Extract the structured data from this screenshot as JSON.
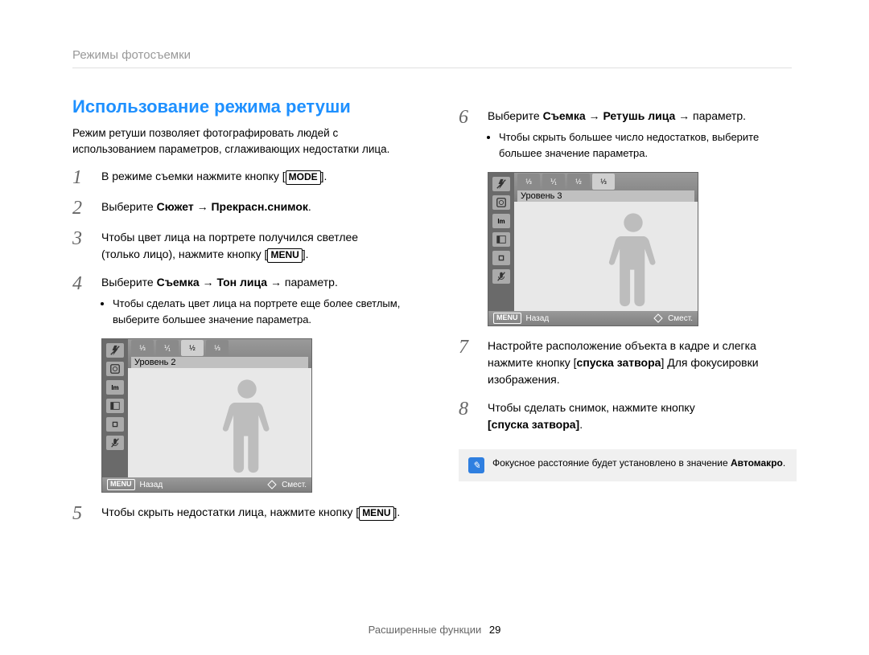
{
  "header": {
    "breadcrumb": "Режимы фотосъемки"
  },
  "section_title": "Использование режима ретуши",
  "intro": "Режим ретуши позволяет фотографировать людей с использованием параметров, сглаживающих недостатки лица.",
  "steps": {
    "s1": {
      "num": "1",
      "pre": "В режиме съемки нажмите кнопку [",
      "btn": "MODE",
      "post": "]."
    },
    "s2": {
      "num": "2",
      "text_before": "Выберите ",
      "bold": "Сюжет → Прекрасн.снимок",
      "text_after": "."
    },
    "s3": {
      "num": "3",
      "line1": "Чтобы цвет лица на портрете получился светлее",
      "line2_pre": "(только лицо), нажмите кнопку [",
      "btn": "MENU",
      "line2_post": "]."
    },
    "s4": {
      "num": "4",
      "text_before": "Выберите ",
      "bold": "Съемка → Тон лица",
      "text_after": " → параметр.",
      "bullet": "Чтобы сделать цвет лица на портрете еще более светлым, выберите большее значение параметра."
    },
    "s5": {
      "num": "5",
      "pre": "Чтобы скрыть недостатки лица, нажмите кнопку [",
      "btn": "MENU",
      "post": "]."
    },
    "s6": {
      "num": "6",
      "text_before": "Выберите ",
      "bold": "Съемка → Ретушь лица",
      "text_after": " → параметр.",
      "bullet": "Чтобы скрыть большее число недостатков, выберите большее значение параметра."
    },
    "s7": {
      "num": "7",
      "part1": "Настройте расположение объекта в кадре и слегка нажмите кнопку [",
      "bold": "спуска затвора",
      "part2": "] Для фокусировки изображения."
    },
    "s8": {
      "num": "8",
      "part1": "Чтобы сделать снимок, нажмите кнопку",
      "bold": "[спуска затвора]",
      "part2": "."
    }
  },
  "lcd": {
    "levels": {
      "left": "Уровень 2",
      "right": "Уровень 3"
    },
    "toolbar": {
      "opt0": "⅓",
      "opt1": "⅟₁",
      "opt2": "½",
      "opt3": "⅓"
    },
    "sidebar_icons": [
      "flash-off-icon",
      "face-detect-icon",
      "resolution-icon",
      "quality-icon",
      "focus-area-icon",
      "mic-off-icon"
    ],
    "status": {
      "back_btn": "MENU",
      "back_label": "Назад",
      "move_label": "Смест."
    }
  },
  "note": {
    "text_before": "Фокусное расстояние будет установлено в значение ",
    "bold": "Автомакро",
    "text_after": "."
  },
  "footer": {
    "label": "Расширенные функции",
    "page": "29"
  }
}
